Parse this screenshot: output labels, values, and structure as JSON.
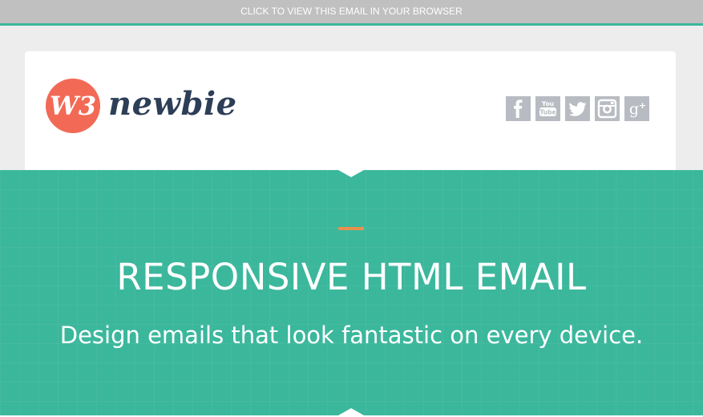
{
  "topbar": {
    "view_in_browser": "CLICK TO VIEW THIS EMAIL IN YOUR BROWSER"
  },
  "header": {
    "logo": {
      "badge_text": "W3",
      "wordmark": "newbie",
      "badge_color": "#f26a55",
      "wordmark_color": "#2d3e57"
    },
    "social": [
      {
        "name": "facebook",
        "icon": "facebook-icon"
      },
      {
        "name": "youtube",
        "icon": "youtube-icon",
        "label": "You Tube"
      },
      {
        "name": "twitter",
        "icon": "twitter-icon"
      },
      {
        "name": "instagram",
        "icon": "instagram-icon"
      },
      {
        "name": "google-plus",
        "icon": "google-plus-icon",
        "label": "g+"
      }
    ]
  },
  "hero": {
    "title": "RESPONSIVE HTML EMAIL",
    "subtitle": "Design emails that look fantastic on every device."
  },
  "colors": {
    "topbar_bg": "#c0c0c0",
    "topbar_border": "#3bb79c",
    "page_bg": "#ededed",
    "hero_bg": "#3bb79c",
    "accent": "#e8914d",
    "social_icon_bg": "#b8bcc2"
  }
}
